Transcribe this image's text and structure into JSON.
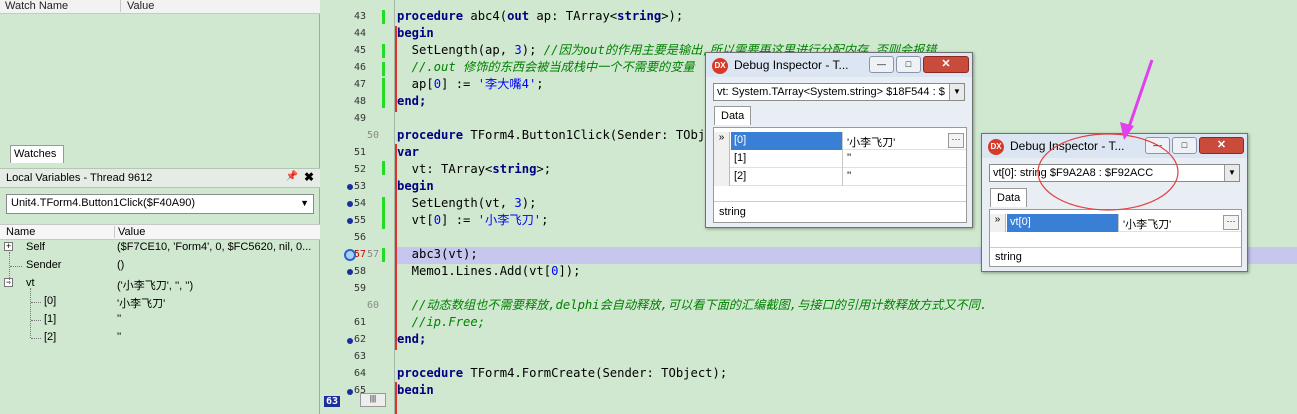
{
  "watch_panel": {
    "col_name": "Watch Name",
    "col_value": "Value",
    "tab": "Watches"
  },
  "locals": {
    "title": "Local Variables - Thread 9612",
    "pin_icon": "pin-icon",
    "close_icon": "close-icon",
    "frame": "Unit4.TForm4.Button1Click($F40A90)",
    "col_name": "Name",
    "col_value": "Value",
    "rows": [
      {
        "name": "Self",
        "value": "($F7CE10, 'Form4', 0, $FC5620, nil, 0..."
      },
      {
        "name": "Sender",
        "value": "()"
      },
      {
        "name": "vt",
        "value": "('小李飞刀', '', '')"
      },
      {
        "name": "[0]",
        "value": "'小李飞刀'"
      },
      {
        "name": "[1]",
        "value": "''"
      },
      {
        "name": "[2]",
        "value": "''"
      }
    ]
  },
  "editor": {
    "line_numbers": [
      "43",
      "44",
      "45",
      "46",
      "47",
      "48",
      "49",
      "50",
      "51",
      "52",
      "53",
      "54",
      "55",
      "56",
      "57",
      "58",
      "59",
      "60",
      "61",
      "62",
      "63",
      "64",
      "65"
    ],
    "gutter_marks": {
      "50": "50",
      "57": "57",
      "60": "60"
    },
    "current_line": "63",
    "lines": {
      "l43a": "procedure",
      "l43b": " abc4(",
      "l43c": "out",
      "l43d": " ap: TArray<",
      "l43e": "string",
      "l43f": ">);",
      "l44": "begin",
      "l45a": "  SetLength(ap, ",
      "l45b": "3",
      "l45c": "); ",
      "l45d": "//因为out的作用主要是输出,所以需要再这里进行分配内存,否则会报错",
      "l46": "  //.out 修饰的东西会被当成栈中一个不需要的变量",
      "l47a": "  ap[",
      "l47b": "0",
      "l47c": "] := ",
      "l47d": "'李大嘴4'",
      "l47e": ";",
      "l48": "end;",
      "l50a": "procedure",
      "l50b": " TForm4.Button1Click(Sender: TObject);",
      "l51": "var",
      "l52a": "  vt: TArray<",
      "l52b": "string",
      "l52c": ">;",
      "l53": "begin",
      "l54a": "  SetLength(vt, ",
      "l54b": "3",
      "l54c": ");",
      "l55a": "  vt[",
      "l55b": "0",
      "l55c": "] := ",
      "l55d": "'小李飞刀'",
      "l55e": ";",
      "l57": "  abc3(vt);",
      "l58a": "  Memo1.Lines.Add(vt[",
      "l58b": "0",
      "l58c": "]);",
      "l60": "  //动态数组也不需要释放,delphi会自动释放,可以看下面的汇编截图,与接口的引用计数释放方式又不同.",
      "l61": "  //ip.Free;",
      "l62": "end;",
      "l64a": "procedure",
      "l64b": " TForm4.FormCreate(Sender: TObject);",
      "l65": "begin"
    }
  },
  "inspector1": {
    "title": "Debug Inspector - T...",
    "expr": "vt: System.TArray<System.string> $18F544 : $",
    "tab": "Data",
    "rows": [
      {
        "idx": "[0]",
        "val": "'小李飞刀'"
      },
      {
        "idx": "[1]",
        "val": "''"
      },
      {
        "idx": "[2]",
        "val": "''"
      }
    ],
    "status": "string"
  },
  "inspector2": {
    "title": "Debug Inspector - T...",
    "expr": "vt[0]: string $F9A2A8 : $F92ACC",
    "tab": "Data",
    "rows": [
      {
        "idx": "vt[0]",
        "val": "'小李飞刀'"
      }
    ],
    "status": "string"
  },
  "colors": {
    "annotation": "#e040ee",
    "circle": "#e04040",
    "accent": "#3a7fd6"
  }
}
